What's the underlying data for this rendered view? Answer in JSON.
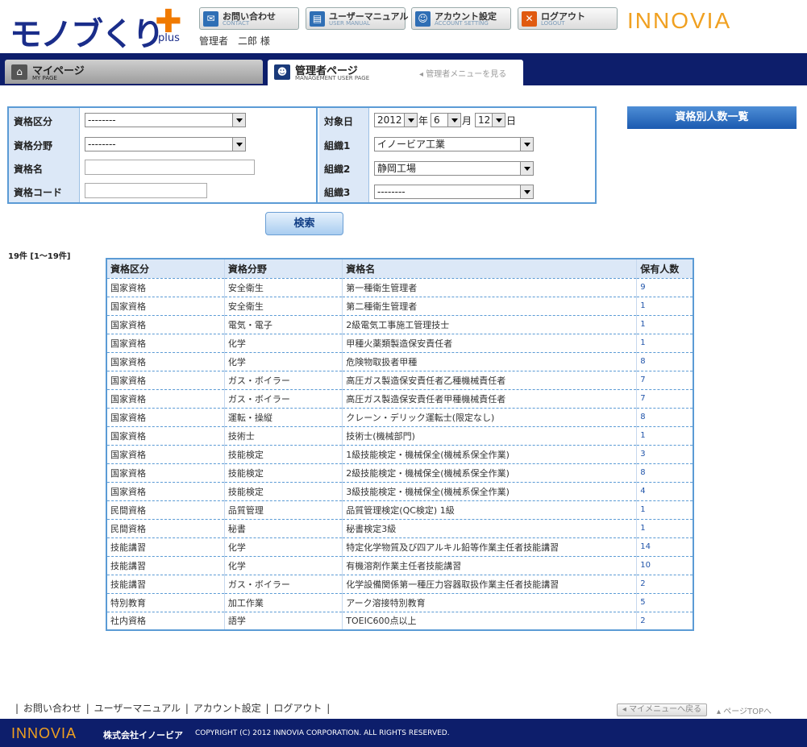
{
  "header": {
    "logo_text": "モノブくり",
    "logo_plus": "✚",
    "logo_sub": "plus",
    "user_name": "管理者　二郎 様",
    "brand": "INNOVIA",
    "buttons": [
      {
        "label": "お問い合わせ",
        "sub": "CONTACT",
        "icon": "mail-icon",
        "color": "#2f6fb5"
      },
      {
        "label": "ユーザーマニュアル",
        "sub": "USER MANUAL",
        "icon": "book-icon",
        "color": "#2f6fb5"
      },
      {
        "label": "アカウント設定",
        "sub": "ACCOUNT SETTING",
        "icon": "person-icon",
        "color": "#2f6fb5"
      },
      {
        "label": "ログアウト",
        "sub": "LOGOUT",
        "icon": "logout-icon",
        "color": "#e05a10"
      }
    ]
  },
  "nav": {
    "mypage": {
      "label": "マイページ",
      "sub": "MY PAGE"
    },
    "admin": {
      "label": "管理者ページ",
      "sub": "MANAGEMENT USER PAGE",
      "menu_link": "◂ 管理者メニューを見る"
    }
  },
  "form": {
    "labels": {
      "category": "資格区分",
      "field": "資格分野",
      "name": "資格名",
      "code": "資格コード",
      "date": "対象日",
      "org1": "組織1",
      "org2": "組織2",
      "org3": "組織3"
    },
    "values": {
      "category": "--------",
      "field": "--------",
      "name": "",
      "code": "",
      "year": "2012",
      "month": "6",
      "day": "12",
      "org1": "イノービア工業",
      "org2": "静岡工場",
      "org3": "--------"
    },
    "units": {
      "year": "年",
      "month": "月",
      "day": "日"
    },
    "search_button": "検索",
    "count_button": "資格別人数一覧"
  },
  "result_count": "19件 [1～19件]",
  "table": {
    "headers": [
      "資格区分",
      "資格分野",
      "資格名",
      "保有人数"
    ],
    "rows": [
      [
        "国家資格",
        "安全衛生",
        "第一種衛生管理者",
        "9"
      ],
      [
        "国家資格",
        "安全衛生",
        "第二種衛生管理者",
        "1"
      ],
      [
        "国家資格",
        "電気・電子",
        "2級電気工事施工管理技士",
        "1"
      ],
      [
        "国家資格",
        "化学",
        "甲種火薬類製造保安責任者",
        "1"
      ],
      [
        "国家資格",
        "化学",
        "危険物取扱者甲種",
        "8"
      ],
      [
        "国家資格",
        "ガス・ボイラー",
        "高圧ガス製造保安責任者乙種機械責任者",
        "7"
      ],
      [
        "国家資格",
        "ガス・ボイラー",
        "高圧ガス製造保安責任者甲種機械責任者",
        "7"
      ],
      [
        "国家資格",
        "運転・操縦",
        "クレーン・デリック運転士(限定なし)",
        "8"
      ],
      [
        "国家資格",
        "技術士",
        "技術士(機械部門)",
        "1"
      ],
      [
        "国家資格",
        "技能検定",
        "1級技能検定・機械保全(機械系保全作業)",
        "3"
      ],
      [
        "国家資格",
        "技能検定",
        "2級技能検定・機械保全(機械系保全作業)",
        "8"
      ],
      [
        "国家資格",
        "技能検定",
        "3級技能検定・機械保全(機械系保全作業)",
        "4"
      ],
      [
        "民間資格",
        "品質管理",
        "品質管理検定(QC検定) 1級",
        "1"
      ],
      [
        "民間資格",
        "秘書",
        "秘書検定3級",
        "1"
      ],
      [
        "技能講習",
        "化学",
        "特定化学物質及び四アルキル鉛等作業主任者技能講習",
        "14"
      ],
      [
        "技能講習",
        "化学",
        "有機溶剤作業主任者技能講習",
        "10"
      ],
      [
        "技能講習",
        "ガス・ボイラー",
        "化学設備関係第一種圧力容器取扱作業主任者技能講習",
        "2"
      ],
      [
        "特別教育",
        "加工作業",
        "アーク溶接特別教育",
        "5"
      ],
      [
        "社内資格",
        "語学",
        "TOEIC600点以上",
        "2"
      ]
    ]
  },
  "footer": {
    "links": [
      "お問い合わせ",
      "ユーザーマニュアル",
      "アカウント設定",
      "ログアウト"
    ],
    "back_button": "◂ マイメニューへ戻る",
    "page_top": "▴ ページTOPへ",
    "brand": "INNOVIA",
    "company": "株式会社イノービア",
    "copyright": "COPYRIGHT (C) 2012 INNOVIA CORPORATION. ALL RIGHTS RESERVED."
  }
}
